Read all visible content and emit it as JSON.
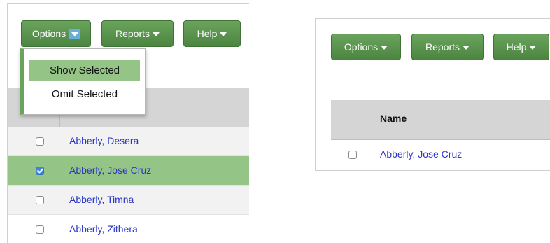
{
  "left": {
    "toolbar": {
      "options_label": "Options",
      "reports_label": "Reports",
      "help_label": "Help"
    },
    "options_menu": {
      "items": [
        "Show Selected",
        "Omit Selected"
      ],
      "highlighted": "Show Selected"
    },
    "rows": [
      {
        "name": "Abberly, Desera",
        "checked": false
      },
      {
        "name": "Abberly, Jose Cruz",
        "checked": true
      },
      {
        "name": "Abberly, Timna",
        "checked": false
      },
      {
        "name": "Abberly, Zithera",
        "checked": false
      }
    ]
  },
  "right": {
    "toolbar": {
      "options_label": "Options",
      "reports_label": "Reports",
      "help_label": "Help"
    },
    "table": {
      "header_name": "Name",
      "rows": [
        {
          "name": "Abberly, Jose Cruz",
          "checked": false
        }
      ]
    }
  },
  "colors": {
    "button_green": "#4b8540",
    "selected_row": "#95c487",
    "link_blue": "#2a35c7",
    "checkbox_blue": "#3d85e0"
  }
}
